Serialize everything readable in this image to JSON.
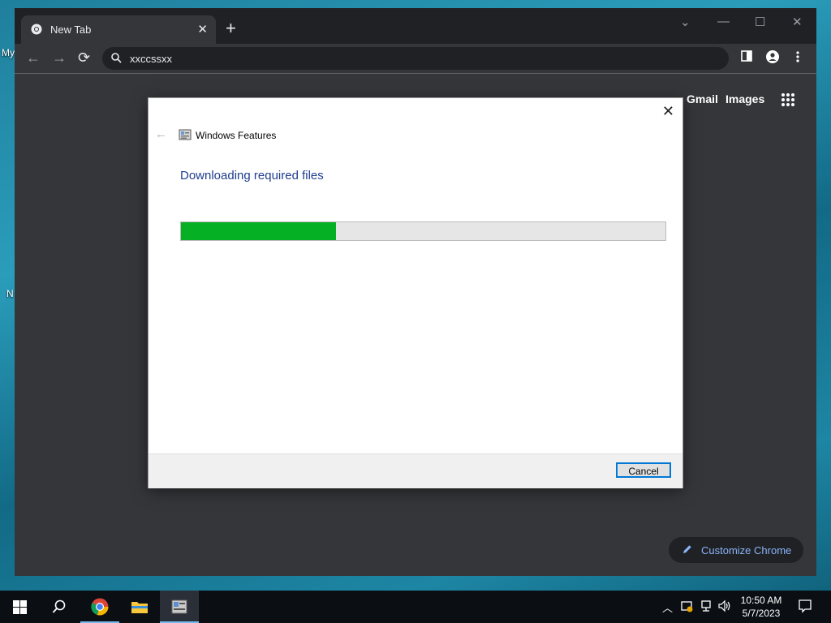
{
  "desktop": {
    "labels": [
      "My",
      "N"
    ]
  },
  "browser": {
    "tab": {
      "title": "New Tab"
    },
    "omnibox": {
      "value": "xxccssxx"
    },
    "links": {
      "gmail": "Gmail",
      "images": "Images"
    },
    "customize": {
      "label": "Customize Chrome"
    }
  },
  "dialog": {
    "app_title": "Windows Features",
    "heading": "Downloading required files",
    "progress": {
      "fraction": 0.32,
      "fill_color": "#06b025"
    },
    "cancel_label": "Cancel"
  },
  "taskbar": {
    "time": "10:50 AM",
    "date": "5/7/2023",
    "items": [
      "start-icon",
      "search-icon",
      "chrome-icon",
      "file-explorer-icon",
      "windows-features-icon"
    ]
  }
}
